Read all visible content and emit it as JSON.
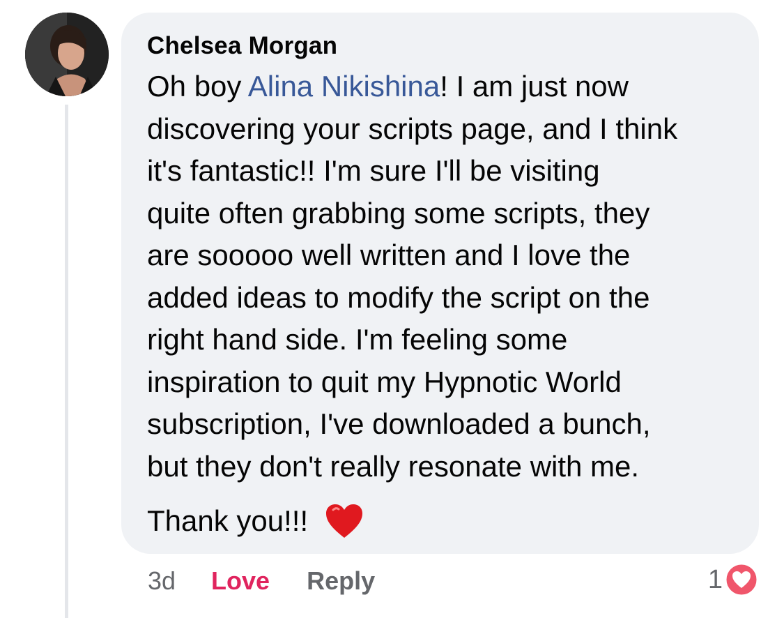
{
  "comment": {
    "author": "Chelsea Morgan",
    "avatar_icon": "profile-photo",
    "text_prefix": "Oh boy ",
    "mention": "Alina Nikishina",
    "line1_suffix": "!  I am just now",
    "lines": [
      "discovering your scripts page, and I think",
      "it's fantastic!!  I'm sure I'll be visiting",
      "quite often grabbing some scripts, they",
      "are sooooo well written and I love the",
      "added ideas to modify the script on the",
      "right hand side.  I'm feeling some",
      "inspiration to quit my Hypnotic World",
      "subscription, I've downloaded a bunch,",
      "but they don't really resonate with me."
    ],
    "closing": "Thank you!!!",
    "closing_emoji": "red-heart-emoji"
  },
  "actions": {
    "timestamp": "3d",
    "love_label": "Love",
    "reply_label": "Reply"
  },
  "reactions": {
    "count": "1",
    "icon": "love-reaction-icon"
  },
  "colors": {
    "bubble": "#f0f2f5",
    "mention": "#385898",
    "love": "#e0245e",
    "muted": "#65676b"
  }
}
